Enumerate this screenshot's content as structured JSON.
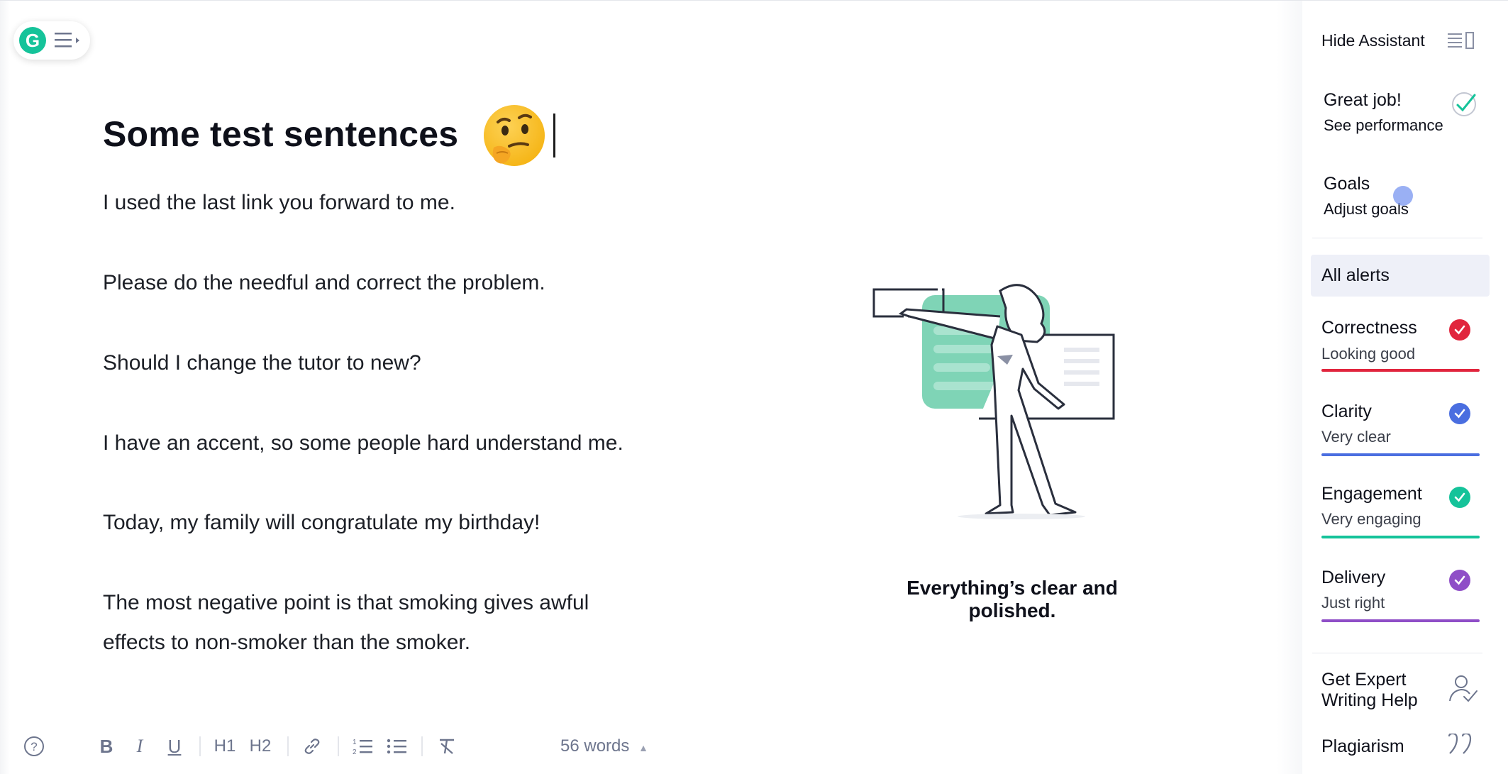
{
  "document": {
    "title": "Some test sentences",
    "emoji": "thinking-face",
    "paragraphs": [
      "I used the last link you forward to me.",
      "Please do the needful and correct the problem.",
      "Should I change the tutor to new?",
      "I have an accent, so some people hard understand me.",
      "Today, my family will congratulate my birthday!",
      "The most negative point is that smoking gives awful",
      "effects to non-smoker than the smoker."
    ]
  },
  "empty_state": {
    "message": "Everything’s clear and polished."
  },
  "toolbar": {
    "help": "?",
    "bold": "B",
    "italic": "I",
    "underline": "U",
    "h1": "H1",
    "h2": "H2",
    "word_count": "56 words"
  },
  "sidebar": {
    "hide_assistant": "Hide Assistant",
    "performance": {
      "title": "Great job!",
      "link": "See performance"
    },
    "goals": {
      "title": "Goals",
      "link": "Adjust goals"
    },
    "all_alerts": "All alerts",
    "categories": [
      {
        "name": "Correctness",
        "status": "Looking good",
        "color": "#e1253d"
      },
      {
        "name": "Clarity",
        "status": "Very clear",
        "color": "#4a6ee0"
      },
      {
        "name": "Engagement",
        "status": "Very engaging",
        "color": "#15c39a"
      },
      {
        "name": "Delivery",
        "status": "Just right",
        "color": "#8f4ec7"
      }
    ],
    "expert_help": "Get Expert Writing Help",
    "plagiarism": "Plagiarism"
  },
  "colors": {
    "brand": "#15c39a",
    "text": "#0e101a",
    "muted": "#6d758d"
  }
}
